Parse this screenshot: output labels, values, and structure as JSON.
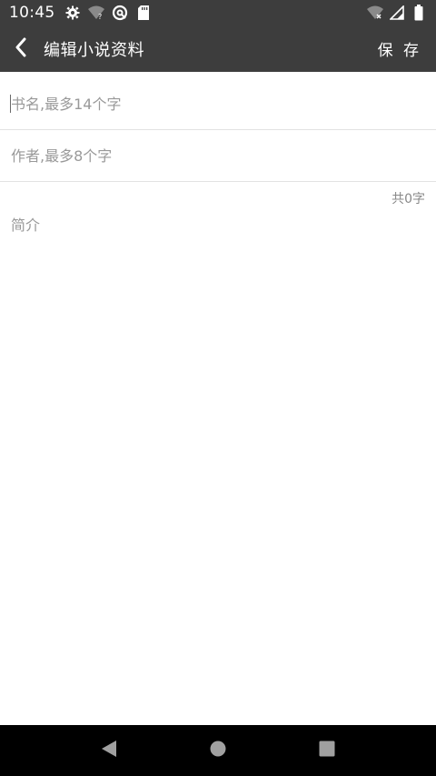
{
  "status_bar": {
    "time": "10:45",
    "left_icons": [
      "gear-icon",
      "wifi-question-icon",
      "vpn-icon",
      "sd-card-icon"
    ],
    "right_icons": [
      "wifi-x-icon",
      "signal-icon",
      "battery-icon"
    ]
  },
  "app_bar": {
    "title": "编辑小说资料",
    "save_label": "保 存",
    "background": "#3d3d3d"
  },
  "form": {
    "title_placeholder": "书名,最多14个字",
    "author_placeholder": "作者,最多8个字",
    "word_count": "共0字",
    "intro_placeholder": "简介"
  },
  "nav_bar": {
    "buttons": [
      "back-triangle-icon",
      "home-circle-icon",
      "recents-square-icon"
    ]
  }
}
